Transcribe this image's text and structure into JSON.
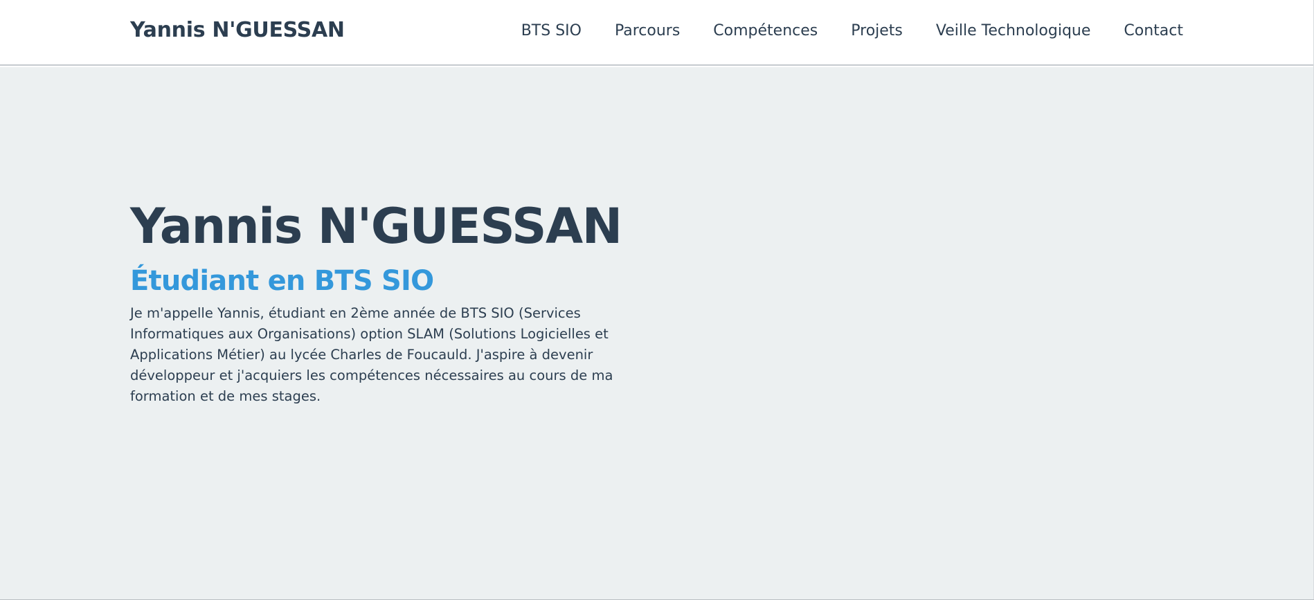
{
  "header": {
    "brand": "Yannis N'GUESSAN",
    "nav": [
      {
        "label": "BTS SIO"
      },
      {
        "label": "Parcours"
      },
      {
        "label": "Compétences"
      },
      {
        "label": "Projets"
      },
      {
        "label": "Veille Technologique"
      },
      {
        "label": "Contact"
      }
    ]
  },
  "hero": {
    "title": "Yannis N'GUESSAN",
    "subtitle": "Étudiant en BTS SIO",
    "description": "Je m'appelle Yannis, étudiant en 2ème année de BTS SIO (Services Informatiques aux Organisations) option SLAM (Solutions Logicielles et Applications Métier) au lycée Charles de Foucauld. J'aspire à devenir développeur et j'acquiers les compétences nécessaires au cours de ma formation et de mes stages."
  },
  "colors": {
    "text_dark": "#2c3e50",
    "accent": "#3498db",
    "hero_background": "#ecf0f1",
    "header_background": "#ffffff"
  }
}
